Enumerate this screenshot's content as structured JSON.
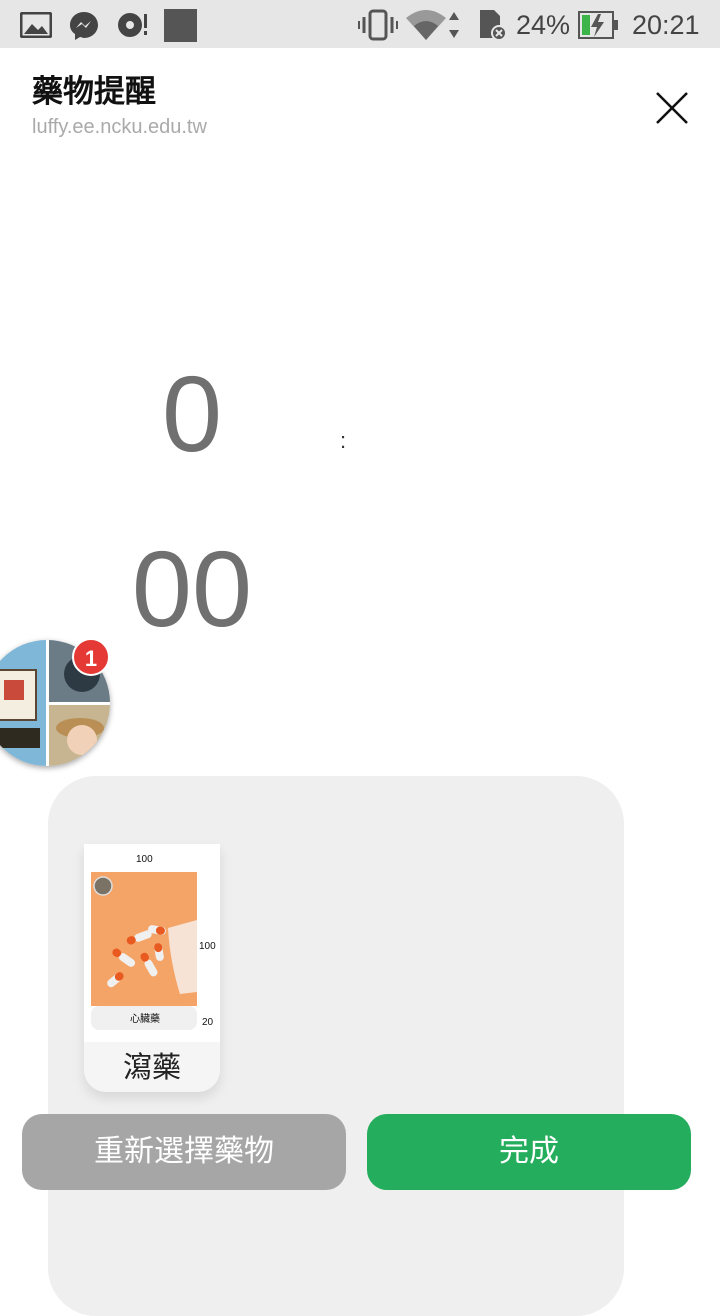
{
  "status_bar": {
    "battery": "24%",
    "time": "20:21",
    "icons": [
      "image-icon",
      "messenger-icon",
      "sync-alert-icon",
      "app-square-icon",
      "vibrate-icon",
      "wifi-icon",
      "sd-card-icon",
      "battery-charging-icon"
    ]
  },
  "header": {
    "title": "藥物提醒",
    "subtitle": "luffy.ee.ncku.edu.tw"
  },
  "time_picker": {
    "hour": "0",
    "separator": ":",
    "minute": "00"
  },
  "chat_head": {
    "badge_count": "1"
  },
  "medication_card": {
    "image_caption": "心臟藥",
    "label": "瀉藥",
    "annotations": {
      "top": "100",
      "right": "100",
      "bottom_right": "20"
    }
  },
  "buttons": {
    "reselect": "重新選擇藥物",
    "done": "完成"
  },
  "colors": {
    "done_button": "#23ad5c",
    "reselect_button": "#a6a6a6",
    "badge": "#e53935"
  }
}
